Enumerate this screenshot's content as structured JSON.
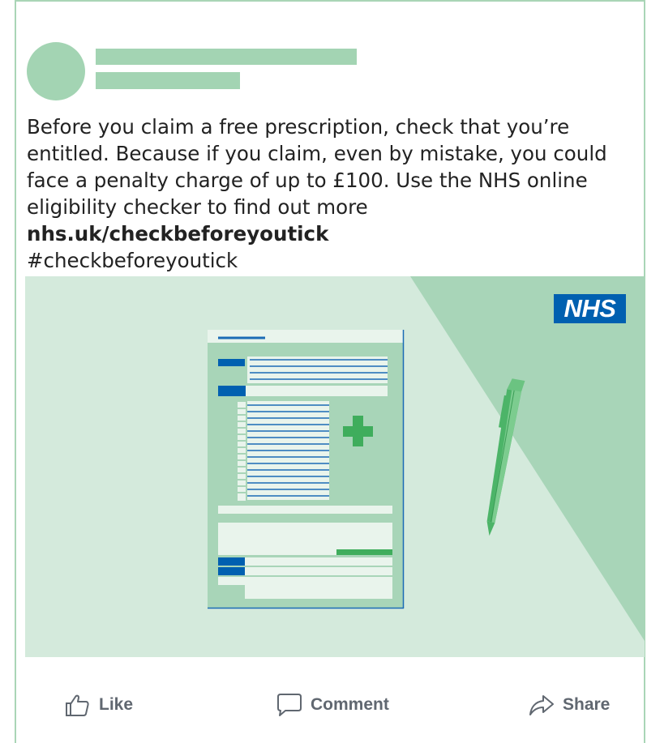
{
  "post": {
    "text_before": "Before you claim a free prescription, check that you’re entitled. Because if you claim, even by mistake, you could face a penalty charge of up to £100. Use the NHS online eligibility checker to find out more ",
    "link_text": "nhs.uk/checkbeforeyoutick",
    "hashtag": "#checkbeforeyoutick"
  },
  "image": {
    "logo_text": "NHS",
    "icons": [
      "prescription-form-illustration",
      "medical-cross-icon",
      "pen-illustration",
      "nhs-logo"
    ]
  },
  "actions": {
    "like": "Like",
    "comment": "Comment",
    "share": "Share"
  },
  "colors": {
    "placeholder": "#a3d4b3",
    "image_bg": "#d4eadc",
    "diagonal": "#a8d5b8",
    "nhs_blue": "#0060b0",
    "cross_green": "#3fad5c",
    "action_text": "#606770"
  }
}
